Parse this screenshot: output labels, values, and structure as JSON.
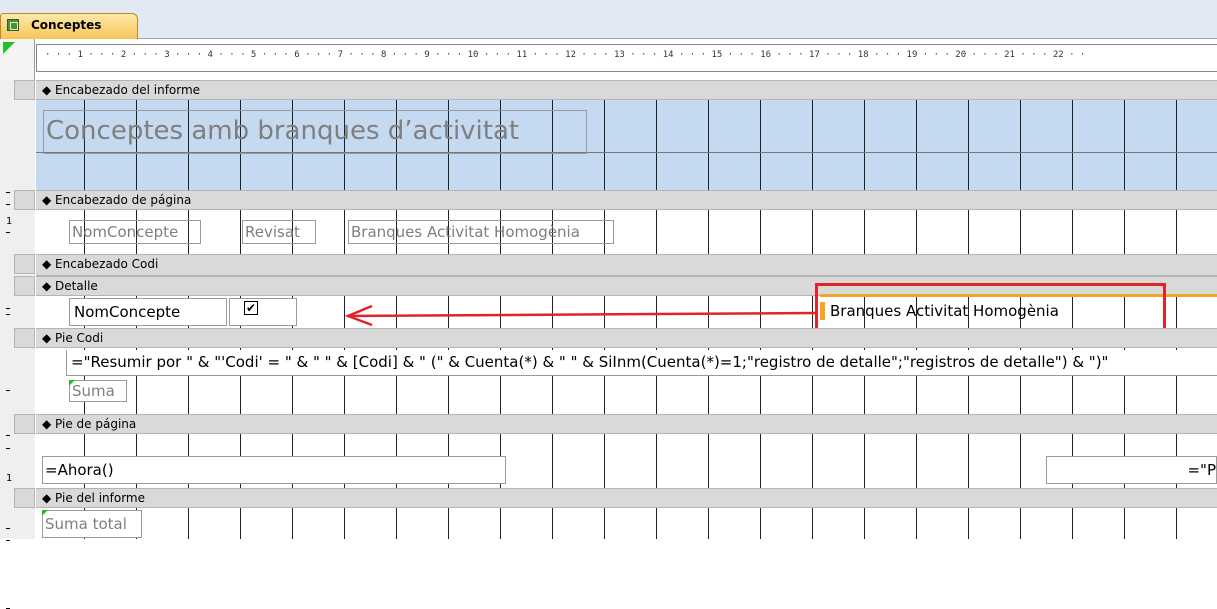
{
  "tab": {
    "title": "Conceptes",
    "icon": "report-icon"
  },
  "ruler": {
    "marks": "· · · 1 · · · 2 · · · 3 · · · 4 · · · 5 · · · 6 · · · 7 · · · 8 · · · 9 · · · 10 · · · 11 · · · 12 · · · 13 · · · 14 · · · 15 · · · 16 · · · 17 · · · 18 · · · 19 · · · 20 · · · 21 · · · 22 · ·"
  },
  "sections": {
    "report_header": {
      "label": "Encabezado del informe",
      "title_label": "Conceptes amb branques d’activitat"
    },
    "page_header": {
      "label": "Encabezado de página",
      "col1": "NomConcepte",
      "col2": "Revisat",
      "col3": "Branques Activitat Homogènia"
    },
    "group_header": {
      "label": "Encabezado Codi"
    },
    "detail": {
      "label": "Detalle",
      "field1": "NomConcepte",
      "checkbox_checked": true,
      "field3": "Branques Activitat Homogènia"
    },
    "group_footer": {
      "label": "Pie Codi",
      "expression": "=\"Resumir por \" & \"'Codi' = \" & \" \" & [Codi] & \" (\" & Cuenta(*) & \" \" & SiInm(Cuenta(*)=1;\"registro de detalle\";\"registros de detalle\") & \")\"",
      "sum_label": "Suma"
    },
    "page_footer": {
      "label": "Pie de página",
      "now_expr": "=Ahora()",
      "page_expr": "=\"P"
    },
    "report_footer": {
      "label": "Pie del informe",
      "total_label": "Suma total"
    }
  },
  "vruler": {
    "h1": "1",
    "h2": "1"
  },
  "colors": {
    "highlight": "#e0242a",
    "arrow": "#e0242a",
    "selection": "#f5a623"
  }
}
